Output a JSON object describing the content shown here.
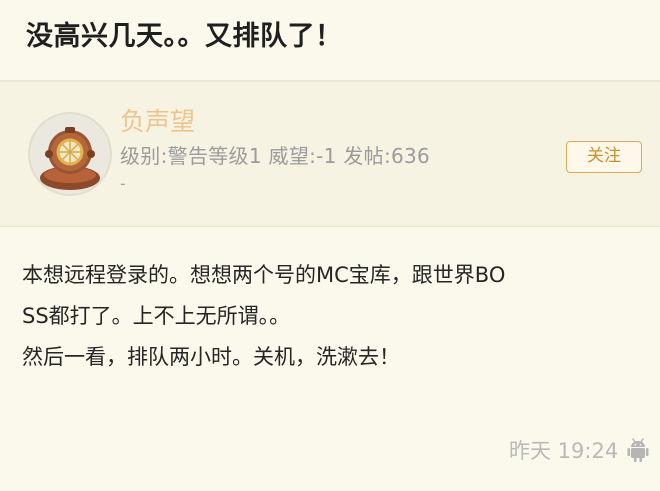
{
  "thread": {
    "title": "没高兴几天。。又排队了！"
  },
  "author": {
    "name": "负声望",
    "meta": "级别:警告等级1 威望:-1 发帖:636",
    "meta_extra": "-",
    "avatar_icon": "diving-helmet-avatar",
    "follow_label": "关注"
  },
  "post": {
    "lines": [
      "本想远程登录的。想想两个号的MC宝库，跟世界BO",
      "SS都打了。上不上无所谓。。",
      "然后一看，排队两小时。关机，洗漱去！"
    ],
    "time": "昨天 19:24",
    "device_icon": "android-icon"
  },
  "colors": {
    "background": "#fbf8ec",
    "author_panel": "#f7f3e3",
    "author_name": "#ecc58e",
    "follow_border": "#d9aa55",
    "follow_text": "#c9912e",
    "meta_text": "#9b9b9b",
    "time_text": "#b9b9b9"
  }
}
